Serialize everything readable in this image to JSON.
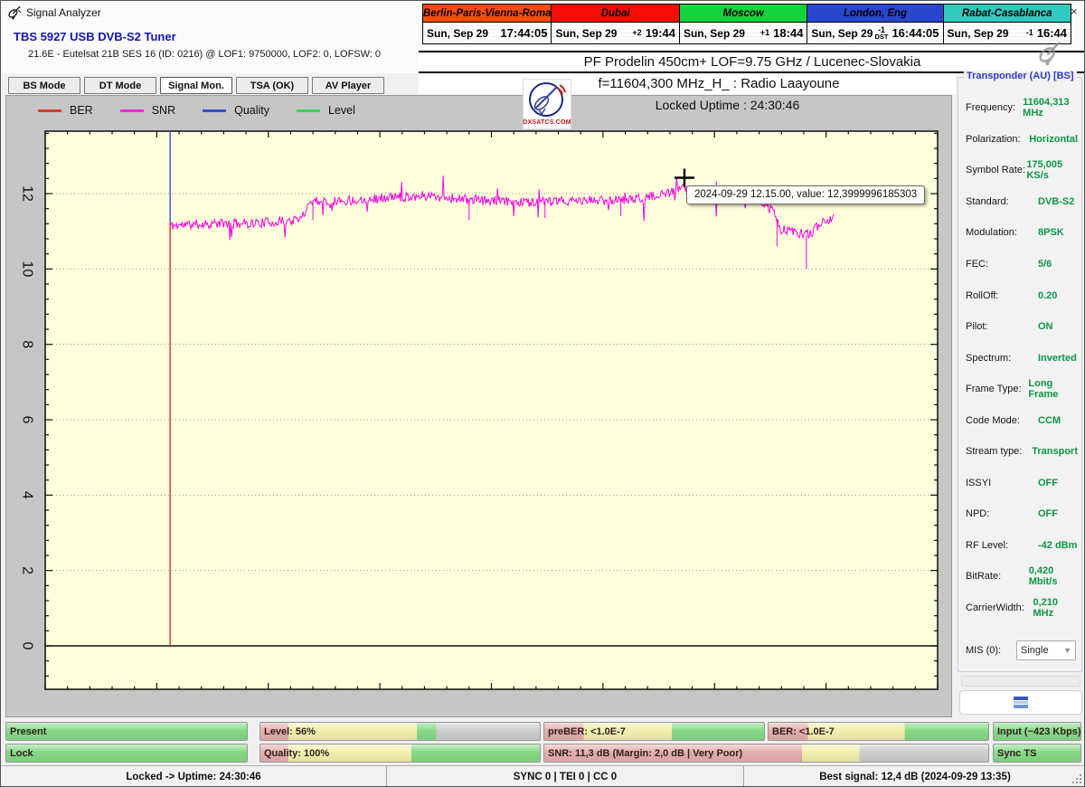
{
  "window": {
    "title": "Signal Analyzer",
    "close": "×"
  },
  "tuner": {
    "title": "TBS 5927 USB DVB-S2 Tuner",
    "subtitle": "21.6E - Eutelsat 21B  SES 16 (ID: 0216) @ LOF1: 9750000, LOF2: 0, LOFSW: 0"
  },
  "clocks": [
    {
      "name": "Berlin-Paris-Vienna-Roma",
      "color": "#ff4d0d",
      "date": "Sun, Sep 29",
      "offset": "",
      "offset_note": "",
      "time": "17:44:05"
    },
    {
      "name": "Dubai",
      "color": "#f90b06",
      "date": "Sun, Sep 29",
      "offset": "+2",
      "offset_note": "",
      "time": "19:44"
    },
    {
      "name": "Moscow",
      "color": "#12d33c",
      "date": "Sun, Sep 29",
      "offset": "+1",
      "offset_note": "",
      "time": "18:44"
    },
    {
      "name": "London, Eng",
      "color": "#2946cf",
      "date": "Sun, Sep 29",
      "offset": "-1",
      "offset_note": "DST",
      "time": "16:44:05"
    },
    {
      "name": "Rabat-Casablanca",
      "color": "#2fc9be",
      "date": "Sun, Sep 29",
      "offset": "-1",
      "offset_note": "",
      "time": "16:44"
    }
  ],
  "header": {
    "site_line": "PF Prodelin 450cm+ LOF=9.75 GHz / Lucenec-Slovakia",
    "freq_line": "f=11604,300 MHz_H_ : Radio Laayoune",
    "uptime_line": "Locked Uptime : 24:30:46",
    "logo": "DXSATCS.COM"
  },
  "tabs": [
    {
      "label": "BS Mode",
      "active": false
    },
    {
      "label": "DT Mode",
      "active": false
    },
    {
      "label": "Signal Mon.",
      "active": true
    },
    {
      "label": "TSA (OK)",
      "active": false
    },
    {
      "label": "AV Player",
      "active": false
    }
  ],
  "legend": [
    {
      "label": "BER",
      "color": "#d93a28"
    },
    {
      "label": "SNR",
      "color": "#ee2ce0"
    },
    {
      "label": "Quality",
      "color": "#3a4fd0"
    },
    {
      "label": "Level",
      "color": "#35d44f"
    }
  ],
  "chart_data": {
    "type": "line",
    "title": "Signal monitor: SNR over time",
    "bg": "#ffffdc",
    "ylim": [
      -1.15,
      13.66
    ],
    "yticks": [
      0,
      2,
      4,
      6,
      8,
      10,
      12
    ],
    "y_minor_step": 0.4,
    "x_major_divisions": 8,
    "x_minor_divisions": 40,
    "grid": "dotted-horizontal",
    "zero_line": 0,
    "series": [
      {
        "name": "BER",
        "color": "#cf3a28",
        "shape": "vline",
        "x_frac": 0.14,
        "v1": 0,
        "v2": 11.25
      },
      {
        "name": "SNR",
        "color": "#f506e0",
        "shape": "noisy",
        "start": 0.14,
        "end": 0.884,
        "noise": 0.13,
        "seed": 11,
        "keypoints": [
          [
            0.14,
            11.15
          ],
          [
            0.18,
            11.2
          ],
          [
            0.24,
            11.22
          ],
          [
            0.285,
            11.3
          ],
          [
            0.298,
            11.82
          ],
          [
            0.33,
            11.8
          ],
          [
            0.36,
            11.85
          ],
          [
            0.4,
            11.92
          ],
          [
            0.43,
            11.95
          ],
          [
            0.47,
            11.85
          ],
          [
            0.52,
            11.78
          ],
          [
            0.57,
            11.78
          ],
          [
            0.62,
            11.82
          ],
          [
            0.66,
            11.85
          ],
          [
            0.69,
            11.95
          ],
          [
            0.705,
            12.05
          ],
          [
            0.716,
            12.15
          ],
          [
            0.725,
            12.0
          ],
          [
            0.74,
            11.95
          ],
          [
            0.77,
            11.9
          ],
          [
            0.8,
            11.82
          ],
          [
            0.815,
            11.55
          ],
          [
            0.825,
            11.05
          ],
          [
            0.845,
            10.95
          ],
          [
            0.855,
            10.9
          ],
          [
            0.862,
            11.05
          ],
          [
            0.872,
            11.3
          ],
          [
            0.884,
            11.35
          ]
        ],
        "spikes": [
          [
            0.716,
            12.42
          ],
          [
            0.752,
            12.33
          ],
          [
            0.853,
            10.0
          ],
          [
            0.3,
            11.3
          ],
          [
            0.475,
            11.3
          ],
          [
            0.56,
            11.35
          ],
          [
            0.645,
            11.4
          ],
          [
            0.82,
            10.6
          ]
        ]
      },
      {
        "name": "Quality",
        "color": "#3c50c8",
        "shape": "vline",
        "x_frac": 0.14,
        "v1": 11.25,
        "v2": 13.66
      },
      {
        "name": "Level",
        "color": "#35d44f",
        "shape": "none"
      }
    ],
    "annotations": {
      "crosshair": {
        "x_frac": 0.7163,
        "value": 12.42
      },
      "tooltip": {
        "text": "2024-09-29 12.15.00, value: 12,3999996185303"
      }
    }
  },
  "transponder": {
    "title": "Transponder (AU) [BS]",
    "rows": [
      {
        "label": "Frequency:",
        "value": "11604,313 MHz"
      },
      {
        "label": "Polarization:",
        "value": "Horizontal"
      },
      {
        "label": "Symbol Rate:",
        "value": "175,005 KS/s"
      },
      {
        "label": "Standard:",
        "value": "DVB-S2"
      },
      {
        "label": "Modulation:",
        "value": "8PSK"
      },
      {
        "label": "FEC:",
        "value": "5/6"
      },
      {
        "label": "RollOff:",
        "value": "0.20"
      },
      {
        "label": "Pilot:",
        "value": "ON"
      },
      {
        "label": "Spectrum:",
        "value": "Inverted"
      },
      {
        "label": "Frame Type:",
        "value": "Long Frame"
      },
      {
        "label": "Code Mode:",
        "value": "CCM"
      },
      {
        "label": "Stream type:",
        "value": "Transport"
      },
      {
        "label": "ISSYI",
        "value": "OFF"
      },
      {
        "label": "NPD:",
        "value": "OFF"
      },
      {
        "label": "RF Level:",
        "value": "-42 dBm"
      },
      {
        "label": "BitRate:",
        "value": "0,420 Mbit/s"
      },
      {
        "label": "CarrierWidth:",
        "value": "0,210 MHz"
      }
    ],
    "mis": {
      "label": "MIS (0):",
      "value": "Single"
    }
  },
  "gauges": {
    "palette": {
      "pink": "#e4aeae",
      "yellow": "#f2efae",
      "green": "#86d986",
      "gray": "#cdcdcd"
    },
    "row1": [
      {
        "label": "Present",
        "segments": [
          [
            "green",
            100
          ]
        ]
      },
      {
        "label": "Level: 56%",
        "segments": [
          [
            "pink",
            10
          ],
          [
            "yellow",
            46
          ],
          [
            "green",
            7
          ],
          [
            "gray",
            37
          ]
        ]
      },
      {
        "label": "preBER: <1.0E-7",
        "segments": [
          [
            "pink",
            18
          ],
          [
            "yellow",
            40
          ],
          [
            "green",
            42
          ]
        ]
      },
      {
        "label": "BER: <1.0E-7",
        "segments": [
          [
            "pink",
            18
          ],
          [
            "yellow",
            44
          ],
          [
            "green",
            38
          ]
        ]
      },
      {
        "label": "Input (~423 Kbps)",
        "segments": [
          [
            "green",
            100
          ]
        ]
      }
    ],
    "row2": [
      {
        "label": "Lock",
        "segments": [
          [
            "green",
            100
          ]
        ]
      },
      {
        "label": "Quality: 100%",
        "segments": [
          [
            "pink",
            10
          ],
          [
            "yellow",
            44
          ],
          [
            "green",
            46
          ]
        ]
      },
      {
        "label": "SNR: 11,3 dB (Margin: 2,0 dB | Very Poor)",
        "segments": [
          [
            "pink",
            58
          ],
          [
            "yellow",
            13
          ],
          [
            "gray",
            29
          ]
        ]
      },
      {
        "label": "Sync TS",
        "segments": [
          [
            "green",
            100
          ]
        ]
      }
    ]
  },
  "statusbar": {
    "sections": [
      "Locked -> Uptime: 24:30:46",
      "SYNC 0 | TEI 0 | CC 0",
      "Best signal: 12,4 dB (2024-09-29 13:35)"
    ]
  }
}
